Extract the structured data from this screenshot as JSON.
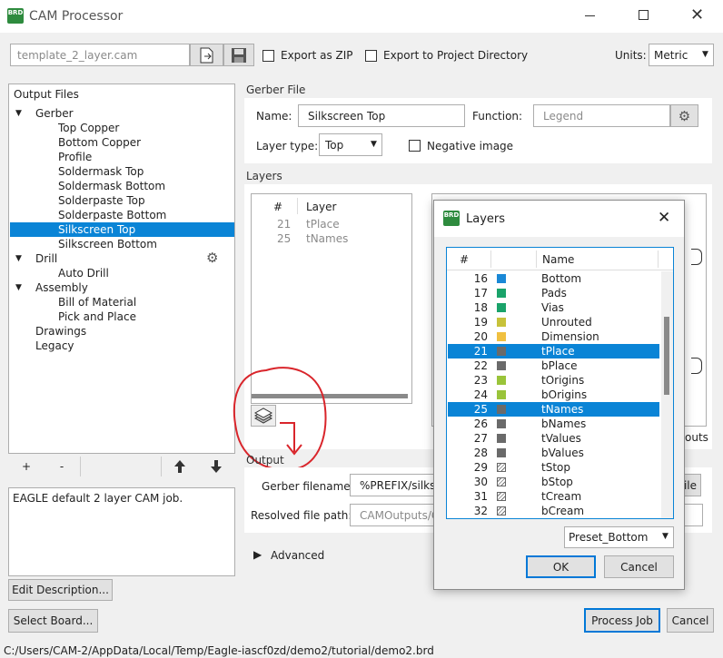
{
  "window": {
    "title": "CAM Processor",
    "icon_text": "BRD"
  },
  "toolbar": {
    "job_file": "template_2_layer.cam",
    "export_zip": "Export as ZIP",
    "export_project": "Export to Project Directory",
    "units_label": "Units:",
    "units_value": "Metric"
  },
  "output_files": {
    "header": "Output Files",
    "items": [
      {
        "label": "Gerber",
        "level": 0,
        "expanded": true
      },
      {
        "label": "Top Copper",
        "level": 2
      },
      {
        "label": "Bottom Copper",
        "level": 2
      },
      {
        "label": "Profile",
        "level": 2
      },
      {
        "label": "Soldermask Top",
        "level": 2
      },
      {
        "label": "Soldermask Bottom",
        "level": 2
      },
      {
        "label": "Solderpaste Top",
        "level": 2
      },
      {
        "label": "Solderpaste Bottom",
        "level": 2
      },
      {
        "label": "Silkscreen Top",
        "level": 2,
        "selected": true
      },
      {
        "label": "Silkscreen Bottom",
        "level": 2
      },
      {
        "label": "Drill",
        "level": 0,
        "expanded": true
      },
      {
        "label": "Auto Drill",
        "level": 2
      },
      {
        "label": "Assembly",
        "level": 0,
        "expanded": true
      },
      {
        "label": "Bill of Material",
        "level": 2
      },
      {
        "label": "Pick and Place",
        "level": 2
      },
      {
        "label": "Drawings",
        "level": 1
      },
      {
        "label": "Legacy",
        "level": 1
      }
    ],
    "add": "+",
    "remove": "-"
  },
  "description": "EAGLE default 2 layer CAM job.",
  "buttons": {
    "edit_description": "Edit Description...",
    "select_board": "Select Board...",
    "process_job": "Process Job",
    "cancel": "Cancel"
  },
  "gerber": {
    "section": "Gerber File",
    "name_label": "Name:",
    "name_value": "Silkscreen Top",
    "function_label": "Function:",
    "function_value": "Legend",
    "layer_type_label": "Layer type:",
    "layer_type_value": "Top",
    "negative_image": "Negative image"
  },
  "layers_section": {
    "title": "Layers",
    "col_num": "#",
    "col_layer": "Layer",
    "rows": [
      {
        "num": "21",
        "name": "tPlace"
      },
      {
        "num": "25",
        "name": "tNames"
      }
    ],
    "right_partial": "outs"
  },
  "output": {
    "section": "Output",
    "gerber_filename_label": "Gerber filename:",
    "gerber_filename_value": "%PREFIX/silksc",
    "resolved_label": "Resolved file path:",
    "resolved_value": "CAMOutputs/G",
    "side_button": "ile"
  },
  "advanced": "Advanced",
  "status_path": "C:/Users/CAM-2/AppData/Local/Temp/Eagle-iascf0zd/demo2/tutorial/demo2.brd",
  "dialog": {
    "title": "Layers",
    "icon_text": "BRD",
    "col_num": "#",
    "col_name": "Name",
    "rows": [
      {
        "num": "16",
        "name": "Bottom",
        "color": "#1a88d6"
      },
      {
        "num": "17",
        "name": "Pads",
        "color": "#1aa36a"
      },
      {
        "num": "18",
        "name": "Vias",
        "color": "#1aa36a"
      },
      {
        "num": "19",
        "name": "Unrouted",
        "color": "#c7c23a"
      },
      {
        "num": "20",
        "name": "Dimension",
        "color": "#f0c040"
      },
      {
        "num": "21",
        "name": "tPlace",
        "color": "#6a6a6a",
        "selected": true
      },
      {
        "num": "22",
        "name": "bPlace",
        "color": "#6a6a6a"
      },
      {
        "num": "23",
        "name": "tOrigins",
        "color": "#9ac43a"
      },
      {
        "num": "24",
        "name": "bOrigins",
        "color": "#9ac43a"
      },
      {
        "num": "25",
        "name": "tNames",
        "color": "#6a6a6a",
        "selected": true
      },
      {
        "num": "26",
        "name": "bNames",
        "color": "#6a6a6a"
      },
      {
        "num": "27",
        "name": "tValues",
        "color": "#6a6a6a"
      },
      {
        "num": "28",
        "name": "bValues",
        "color": "#6a6a6a"
      },
      {
        "num": "29",
        "name": "tStop",
        "color": "hatch"
      },
      {
        "num": "30",
        "name": "bStop",
        "color": "hatch"
      },
      {
        "num": "31",
        "name": "tCream",
        "color": "hatch"
      },
      {
        "num": "32",
        "name": "bCream",
        "color": "hatch"
      }
    ],
    "preset": "Preset_Bottom",
    "ok": "OK",
    "cancel": "Cancel"
  }
}
